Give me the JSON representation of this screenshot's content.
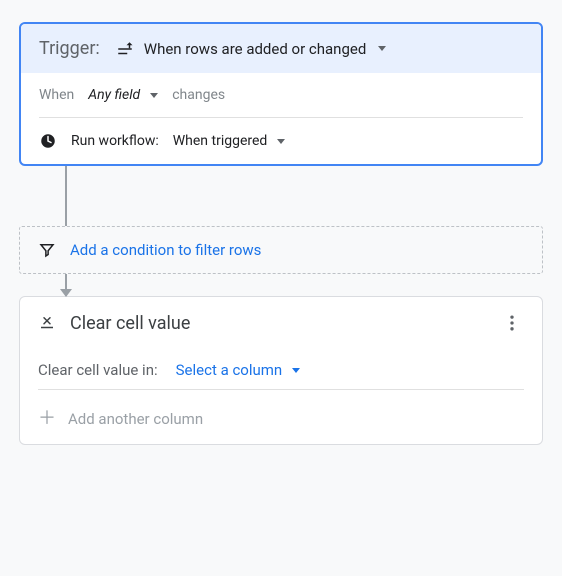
{
  "trigger": {
    "label": "Trigger:",
    "type_text": "When rows are added or changed",
    "when_label": "When",
    "field_value": "Any field",
    "changes_label": "changes",
    "run_label": "Run workflow:",
    "run_value": "When triggered"
  },
  "condition": {
    "add_text": "Add a condition to filter rows"
  },
  "action": {
    "title": "Clear cell value",
    "field_label": "Clear cell value in:",
    "select_placeholder": "Select a column",
    "add_another": "Add another column"
  }
}
